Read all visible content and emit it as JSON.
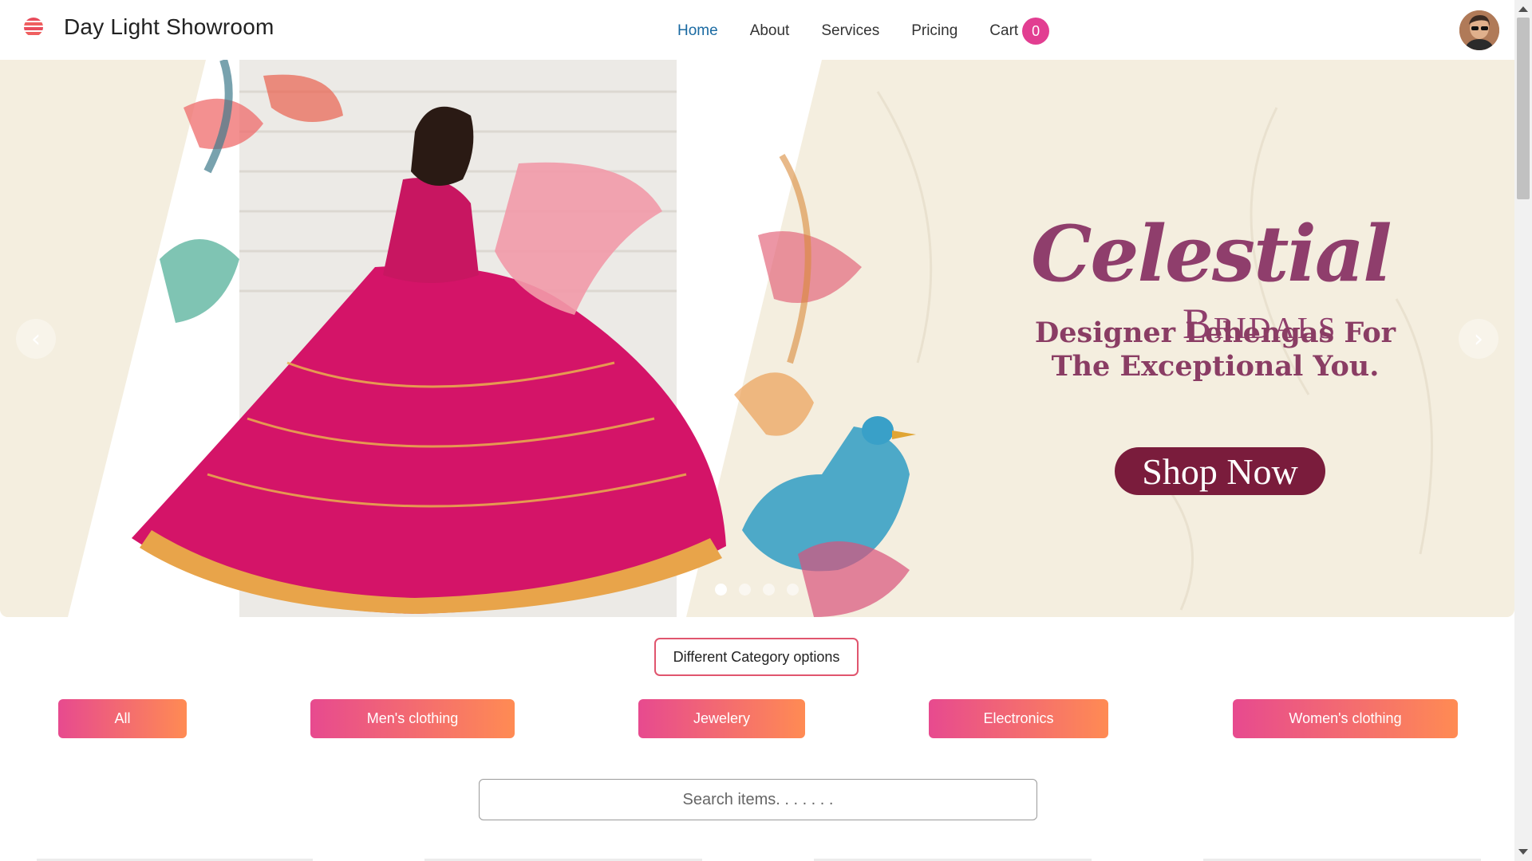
{
  "navbar": {
    "brand_name": "Day Light Showroom",
    "logo_icon": "striped-ball-logo",
    "links": [
      {
        "label": "Home",
        "active": true
      },
      {
        "label": "About"
      },
      {
        "label": "Services"
      },
      {
        "label": "Pricing"
      }
    ],
    "cart": {
      "label": "Cart",
      "count": "0"
    },
    "avatar": "user-avatar"
  },
  "hero": {
    "title": "Celestial",
    "subtitle": "Bridals",
    "tagline": "Designer Lehengas For The Exceptional You.",
    "button_label": "Shop Now",
    "prev_icon": "‹",
    "next_icon": "›",
    "slide_count": 4,
    "active_slide": 1
  },
  "category": {
    "heading": "Different Category options",
    "options": [
      "All",
      "Men's clothing",
      "Jewelery",
      "Electronics",
      "Women's clothing"
    ]
  },
  "search": {
    "placeholder": "Search items. . . . . . ."
  },
  "colors": {
    "accent_pink": "#e74a8f",
    "accent_orange": "#ff8b53",
    "hero_text": "#8f3e6c",
    "shop_button": "#7a1c3c",
    "cart_badge": "#e23e91",
    "active_link": "#1a6aa2"
  }
}
